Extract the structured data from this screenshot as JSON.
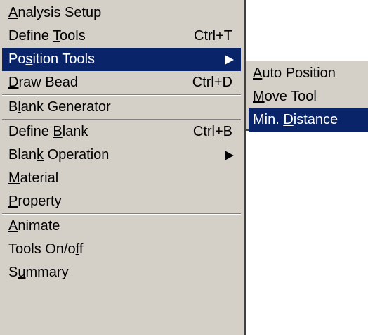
{
  "main_menu": {
    "items": [
      {
        "pre": "",
        "mn": "A",
        "post": "nalysis Setup",
        "shortcut": "",
        "submenu": false,
        "highlighted": false
      },
      {
        "pre": "Define ",
        "mn": "T",
        "post": "ools",
        "shortcut": "Ctrl+T",
        "submenu": false,
        "highlighted": false
      },
      {
        "pre": "Po",
        "mn": "s",
        "post": "ition Tools",
        "shortcut": "",
        "submenu": true,
        "highlighted": true
      },
      {
        "pre": "",
        "mn": "D",
        "post": "raw Bead",
        "shortcut": "Ctrl+D",
        "submenu": false,
        "highlighted": false
      },
      {
        "pre": "B",
        "mn": "l",
        "post": "ank Generator",
        "shortcut": "",
        "submenu": false,
        "highlighted": false
      },
      {
        "pre": "Define ",
        "mn": "B",
        "post": "lank",
        "shortcut": "Ctrl+B",
        "submenu": false,
        "highlighted": false
      },
      {
        "pre": "Blan",
        "mn": "k",
        "post": " Operation",
        "shortcut": "",
        "submenu": true,
        "highlighted": false
      },
      {
        "pre": "",
        "mn": "M",
        "post": "aterial",
        "shortcut": "",
        "submenu": false,
        "highlighted": false
      },
      {
        "pre": "",
        "mn": "P",
        "post": "roperty",
        "shortcut": "",
        "submenu": false,
        "highlighted": false
      },
      {
        "pre": "",
        "mn": "A",
        "post": "nimate",
        "shortcut": "",
        "submenu": false,
        "highlighted": false
      },
      {
        "pre": "Tools On/o",
        "mn": "f",
        "post": "f",
        "shortcut": "",
        "submenu": false,
        "highlighted": false
      },
      {
        "pre": "S",
        "mn": "u",
        "post": "mmary",
        "shortcut": "",
        "submenu": false,
        "highlighted": false
      }
    ]
  },
  "position_tools_submenu": {
    "items": [
      {
        "pre": "",
        "mn": "A",
        "post": "uto Position",
        "highlighted": false
      },
      {
        "pre": "",
        "mn": "M",
        "post": "ove Tool",
        "highlighted": false
      },
      {
        "pre": "Min. ",
        "mn": "D",
        "post": "istance",
        "highlighted": true
      }
    ]
  },
  "colors": {
    "menu_background": "#d4d0c8",
    "highlight_background": "#0a246a",
    "highlight_text": "#ffffff"
  },
  "icons": {
    "submenu_arrow": "arrow-right-icon"
  }
}
